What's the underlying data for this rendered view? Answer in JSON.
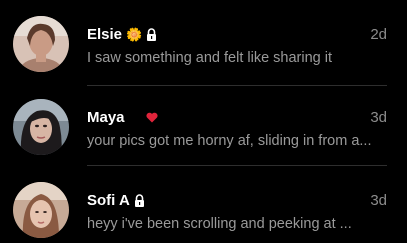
{
  "conversations": [
    {
      "name": "Elsie",
      "emoji": "🌼",
      "lock_icon": "lock-icon",
      "time": "2d",
      "preview": "I saw something and felt like sharing it",
      "avatar_bg": "#c9a89a"
    },
    {
      "name": "Maya",
      "emoji": "😛",
      "emoji2": "❤️",
      "time": "3d",
      "preview": "your pics got me horny af, sliding in from a...",
      "avatar_bg": "#5a6a72"
    },
    {
      "name": "Sofi A",
      "lock_icon": "lock-icon",
      "time": "3d",
      "preview": "heyy i've been scrolling and peeking at ...",
      "avatar_bg": "#b89480"
    }
  ],
  "colors": {
    "background": "#000000",
    "name": "#ffffff",
    "secondary_text": "#9a9a9a",
    "divider": "#2e2e2e",
    "heart": "#e0243b"
  }
}
